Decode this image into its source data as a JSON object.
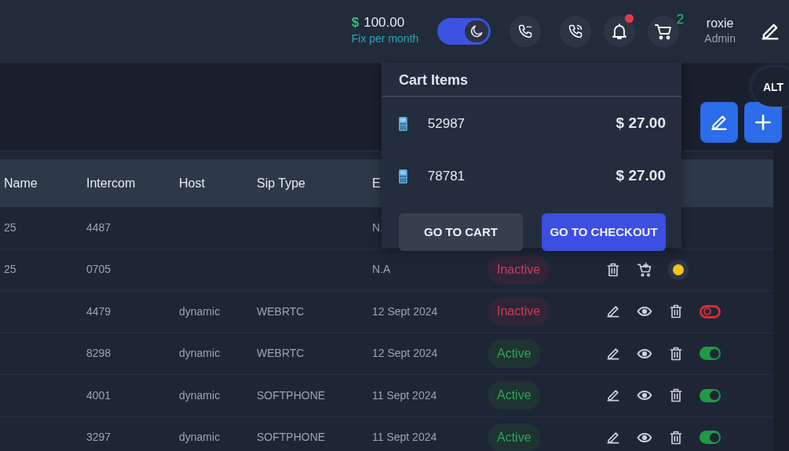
{
  "topbar": {
    "balance": {
      "currency": "$",
      "amount": "100.00",
      "caption": "Fix per month"
    },
    "theme_toggle": {
      "on": true
    },
    "notifications": {
      "unread": true
    },
    "cart": {
      "count": "2"
    },
    "user": {
      "name": "roxie",
      "role": "Admin"
    }
  },
  "key_overlay": {
    "label": "ALT"
  },
  "toolbar": {
    "buttons": [
      {
        "kind": "edit"
      },
      {
        "kind": "add"
      }
    ]
  },
  "table": {
    "columns": [
      "Name",
      "Intercom",
      "Host",
      "Sip Type",
      "E"
    ],
    "rows": [
      {
        "name": "25",
        "intercom": "4487",
        "expiry": "N."
      },
      {
        "name": "25",
        "intercom": "0705",
        "expiry": "N.A",
        "status": {
          "label": "Inactive",
          "active": false
        },
        "actions": [
          {
            "kind": "delete"
          },
          {
            "kind": "add-to-cart"
          },
          {
            "kind": "dot",
            "color": "#f5c518"
          }
        ]
      },
      {
        "intercom": "4479",
        "host": "dynamic",
        "sip_type": "WEBRTC",
        "expiry": "12 Sept 2024",
        "status": {
          "label": "Inactive",
          "active": false
        },
        "actions": [
          {
            "kind": "edit"
          },
          {
            "kind": "view"
          },
          {
            "kind": "delete"
          },
          {
            "kind": "toggle",
            "on": false
          }
        ]
      },
      {
        "intercom": "8298",
        "host": "dynamic",
        "sip_type": "WEBRTC",
        "expiry": "12 Sept 2024",
        "status": {
          "label": "Active",
          "active": true
        },
        "actions": [
          {
            "kind": "edit"
          },
          {
            "kind": "view"
          },
          {
            "kind": "delete"
          },
          {
            "kind": "toggle",
            "on": true
          }
        ]
      },
      {
        "intercom": "4001",
        "host": "dynamic",
        "sip_type": "SOFTPHONE",
        "expiry": "11 Sept 2024",
        "status": {
          "label": "Active",
          "active": true
        },
        "actions": [
          {
            "kind": "edit"
          },
          {
            "kind": "view"
          },
          {
            "kind": "delete"
          },
          {
            "kind": "toggle",
            "on": true
          }
        ]
      },
      {
        "intercom": "3297",
        "host": "dynamic",
        "sip_type": "SOFTPHONE",
        "expiry": "11 Sept 2024",
        "status": {
          "label": "Active",
          "active": true
        },
        "actions": [
          {
            "kind": "edit"
          },
          {
            "kind": "view"
          },
          {
            "kind": "delete"
          },
          {
            "kind": "toggle",
            "on": true
          }
        ]
      }
    ]
  },
  "cart_dropdown": {
    "title": "Cart Items",
    "items": [
      {
        "number": "52987",
        "price": "$ 27.00"
      },
      {
        "number": "78781",
        "price": "$ 27.00"
      }
    ],
    "buttons": [
      {
        "label": "GO TO CART",
        "kind": "secondary"
      },
      {
        "label": "GO TO CHECKOUT",
        "kind": "primary"
      }
    ]
  }
}
